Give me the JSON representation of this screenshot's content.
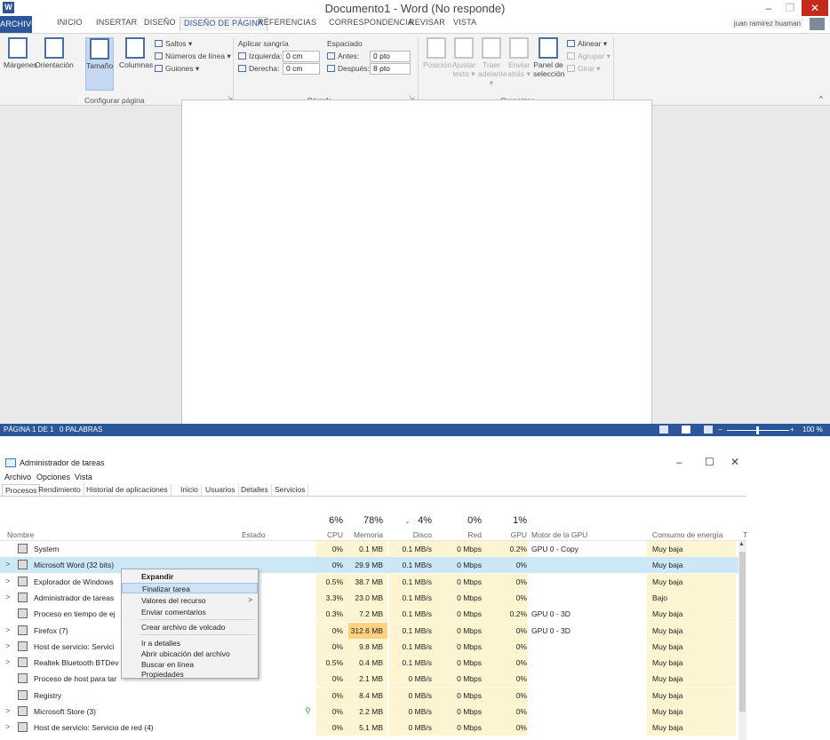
{
  "word": {
    "title": "Documento1 - Word (No responde)",
    "logo_letter": "W",
    "tabs": {
      "file": "ARCHIVO",
      "home": "INICIO",
      "insert": "INSERTAR",
      "design": "DISEÑO",
      "layout": "DISEÑO DE PÁGINA",
      "references": "REFERENCIAS",
      "mailings": "CORRESPONDENCIA",
      "review": "REVISAR",
      "view": "VISTA"
    },
    "user": "juan ramirez huaman",
    "ribbon": {
      "margins": "Márgenes",
      "orientation": "Orientación",
      "size": "Tamaño",
      "columns": "Columnas",
      "breaks": "Saltos ▾",
      "line_numbers": "Números de línea ▾",
      "hyphenation": "Guiones ▾",
      "group_page_setup": "Configurar página",
      "indent_title": "Aplicar sangría",
      "indent_left_label": "Izquierda:",
      "indent_left_value": "0 cm",
      "indent_right_label": "Derecha:",
      "indent_right_value": "0 cm",
      "spacing_title": "Espaciado",
      "spacing_before_label": "Antes:",
      "spacing_before_value": "0 pto",
      "spacing_after_label": "Después:",
      "spacing_after_value": "8 pto",
      "group_paragraph": "Párrafo",
      "position": "Posición",
      "wrap_text": "Ajustar texto ▾",
      "bring_forward": "Traer adelante ▾",
      "send_backward": "Enviar atrás ▾",
      "selection_pane": "Panel de selección",
      "align": "Alinear ▾",
      "group": "Agrupar ▾",
      "rotate": "Girar ▾",
      "group_arrange": "Organizar"
    },
    "status": {
      "page": "PÁGINA 1 DE 1",
      "words": "0 PALABRAS",
      "zoom": "100 %"
    }
  },
  "task_manager": {
    "title": "Administrador de tareas",
    "menu": [
      "Archivo",
      "Opciones",
      "Vista"
    ],
    "tabs": [
      "Procesos",
      "Rendimiento",
      "Historial de aplicaciones",
      "Inicio",
      "Usuarios",
      "Detalles",
      "Servicios"
    ],
    "headers": {
      "name": "Nombre",
      "status": "Estado",
      "cpu_pct": "6%",
      "cpu": "CPU",
      "mem_pct": "78%",
      "mem": "Memoria",
      "disk_pct": "4%",
      "disk": "Disco",
      "net_pct": "0%",
      "net": "Red",
      "gpu_pct": "1%",
      "gpu": "GPU",
      "gpu_engine": "Motor de la GPU",
      "power": "Consumo de energía",
      "power_trend": "T"
    },
    "rows": [
      {
        "name": "System",
        "cpu": "0%",
        "mem": "0.1 MB",
        "disk": "0.1 MB/s",
        "net": "0 Mbps",
        "gpu": "0.2%",
        "engine": "GPU 0 - Copy",
        "power": "Muy baja"
      },
      {
        "name": "Microsoft Word (32 bits)",
        "cpu": "0%",
        "mem": "29.9 MB",
        "disk": "0.1 MB/s",
        "net": "0 Mbps",
        "gpu": "0%",
        "engine": "",
        "power": "Muy baja"
      },
      {
        "name": "Explorador de Windows",
        "cpu": "0.5%",
        "mem": "38.7 MB",
        "disk": "0.1 MB/s",
        "net": "0 Mbps",
        "gpu": "0%",
        "engine": "",
        "power": "Muy baja"
      },
      {
        "name": "Administrador de tareas",
        "cpu": "3.3%",
        "mem": "23.0 MB",
        "disk": "0.1 MB/s",
        "net": "0 Mbps",
        "gpu": "0%",
        "engine": "",
        "power": "Bajo"
      },
      {
        "name": "Proceso en tiempo de ej",
        "cpu": "0.3%",
        "mem": "7.2 MB",
        "disk": "0.1 MB/s",
        "net": "0 Mbps",
        "gpu": "0.2%",
        "engine": "GPU 0 - 3D",
        "power": "Muy baja"
      },
      {
        "name": "Firefox (7)",
        "cpu": "0%",
        "mem": "312.6 MB",
        "disk": "0.1 MB/s",
        "net": "0 Mbps",
        "gpu": "0%",
        "engine": "GPU 0 - 3D",
        "power": "Muy baja"
      },
      {
        "name": "Host de servicio: Servici",
        "cpu": "0%",
        "mem": "9.8 MB",
        "disk": "0.1 MB/s",
        "net": "0 Mbps",
        "gpu": "0%",
        "engine": "",
        "power": "Muy baja"
      },
      {
        "name": "Realtek Bluetooth BTDev",
        "cpu": "0.5%",
        "mem": "0.4 MB",
        "disk": "0.1 MB/s",
        "net": "0 Mbps",
        "gpu": "0%",
        "engine": "",
        "power": "Muy baja"
      },
      {
        "name": "Proceso de host para tar",
        "cpu": "0%",
        "mem": "2.1 MB",
        "disk": "0 MB/s",
        "net": "0 Mbps",
        "gpu": "0%",
        "engine": "",
        "power": "Muy baja"
      },
      {
        "name": "Registry",
        "cpu": "0%",
        "mem": "8.4 MB",
        "disk": "0 MB/s",
        "net": "0 Mbps",
        "gpu": "0%",
        "engine": "",
        "power": "Muy baja"
      },
      {
        "name": "Microsoft Store (3)",
        "cpu": "0%",
        "mem": "2.2 MB",
        "disk": "0 MB/s",
        "net": "0 Mbps",
        "gpu": "0%",
        "engine": "",
        "power": "Muy baja"
      },
      {
        "name": "Host de servicio: Servicio de red (4)",
        "cpu": "0%",
        "mem": "5.1 MB",
        "disk": "0 MB/s",
        "net": "0 Mbps",
        "gpu": "0%",
        "engine": "",
        "power": "Muy baja"
      }
    ],
    "context_menu": [
      "Expandir",
      "Finalizar tarea",
      "Valores del recurso",
      "Enviar comentarios",
      "Crear archivo de volcado",
      "Ir a detalles",
      "Abrir ubicación del archivo",
      "Buscar en línea",
      "Propiedades"
    ]
  }
}
